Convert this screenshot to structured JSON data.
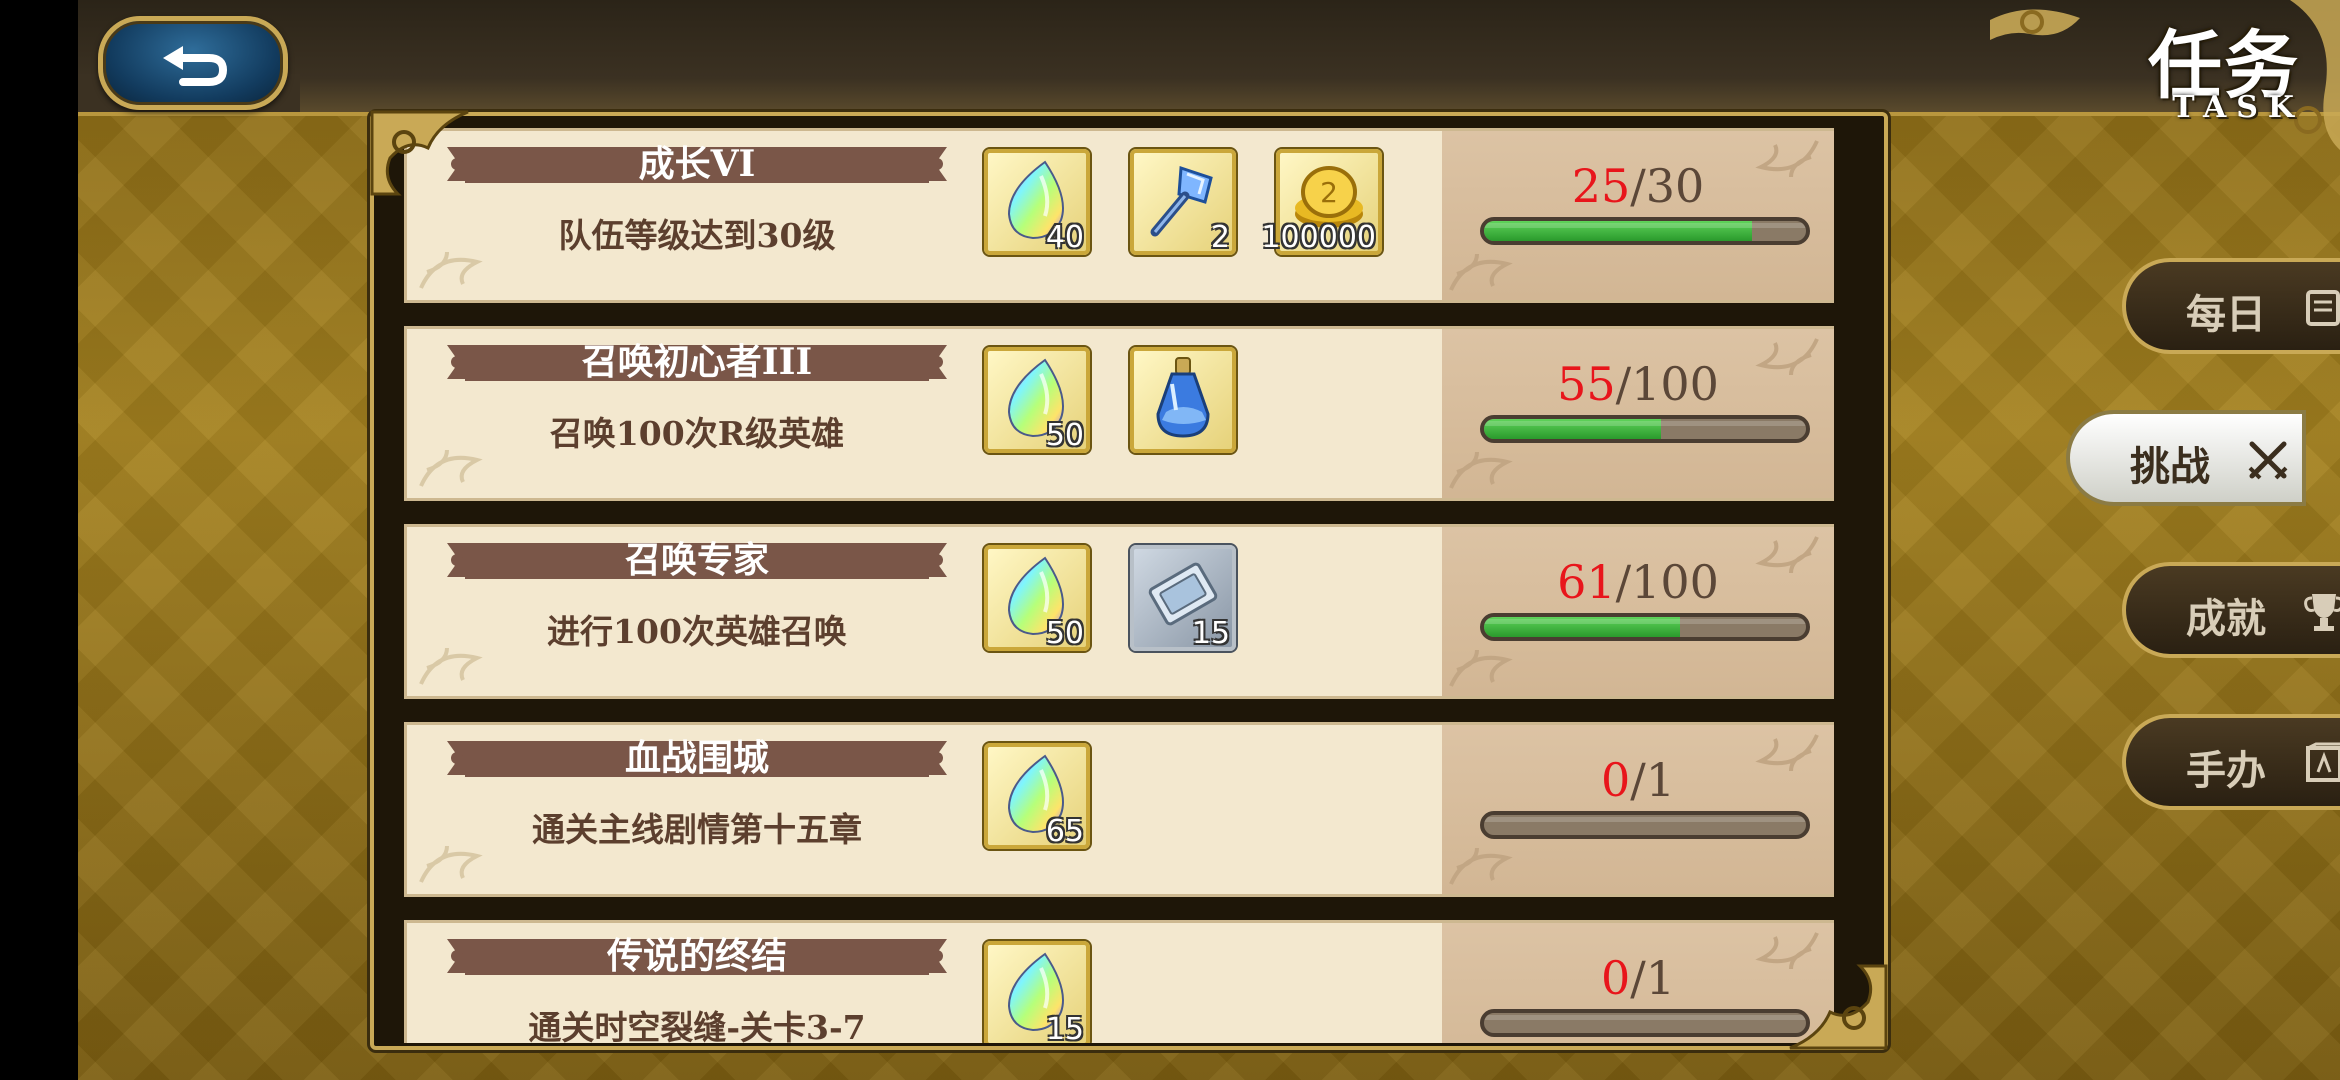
{
  "header": {
    "title": "任务",
    "subtitle": "TASK",
    "back_icon": "back-arrow-icon"
  },
  "tasks": [
    {
      "name": "成长VI",
      "description": "队伍等级达到30级",
      "rewards": [
        {
          "icon": "rainbow-crystal-icon",
          "qty": "40",
          "style": "gold"
        },
        {
          "icon": "blue-crystal-hammer-icon",
          "qty": "2",
          "style": "gold"
        },
        {
          "icon": "gold-coin-icon",
          "qty": "100000",
          "style": "gold"
        }
      ],
      "progress_current": "25",
      "progress_total": "/30",
      "progress_fraction": 0.833
    },
    {
      "name": "召唤初心者III",
      "description": "召唤100次R级英雄",
      "rewards": [
        {
          "icon": "rainbow-crystal-icon",
          "qty": "50",
          "style": "gold"
        },
        {
          "icon": "blue-potion-icon",
          "qty": "",
          "style": "gold"
        }
      ],
      "progress_current": "55",
      "progress_total": "/100",
      "progress_fraction": 0.55
    },
    {
      "name": "召唤专家",
      "description": "进行100次英雄召唤",
      "rewards": [
        {
          "icon": "rainbow-crystal-icon",
          "qty": "50",
          "style": "gold"
        },
        {
          "icon": "summon-ticket-icon",
          "qty": "15",
          "style": "silver"
        }
      ],
      "progress_current": "61",
      "progress_total": "/100",
      "progress_fraction": 0.61
    },
    {
      "name": "血战围城",
      "description": "通关主线剧情第十五章",
      "rewards": [
        {
          "icon": "rainbow-crystal-icon",
          "qty": "65",
          "style": "gold"
        }
      ],
      "progress_current": "0",
      "progress_total": "/1",
      "progress_fraction": 0
    },
    {
      "name": "传说的终结",
      "description": "通关时空裂缝-关卡3-7",
      "rewards": [
        {
          "icon": "rainbow-crystal-icon",
          "qty": "15",
          "style": "gold"
        }
      ],
      "progress_current": "0",
      "progress_total": "/1",
      "progress_fraction": 0
    }
  ],
  "side_tabs": [
    {
      "label": "每日",
      "icon": "scroll-icon",
      "active": false
    },
    {
      "label": "挑战",
      "icon": "crossed-swords-icon",
      "active": true
    },
    {
      "label": "成就",
      "icon": "trophy-icon",
      "active": false
    },
    {
      "label": "手办",
      "icon": "figure-box-icon",
      "active": false
    }
  ],
  "colors": {
    "progress_current": "#e8151b",
    "progress_fill": "#3fb83e",
    "ribbon": "#7a5648",
    "gold_border": "#c9a956"
  }
}
